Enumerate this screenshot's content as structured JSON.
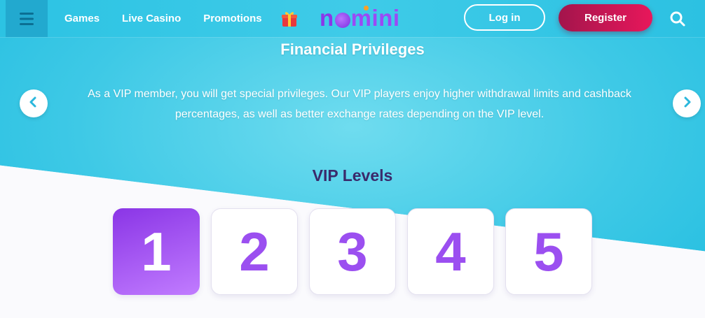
{
  "header": {
    "nav": [
      "Games",
      "Live Casino",
      "Promotions"
    ],
    "logo_text": {
      "n": "n",
      "rest": "mini"
    },
    "login_label": "Log in",
    "register_label": "Register"
  },
  "content": {
    "title": "Financial Privileges",
    "text": "As a VIP member, you will get special privileges. Our VIP players enjoy higher withdrawal limits and cashback percentages, as well as better exchange rates depending on the VIP level.",
    "vip_title": "VIP Levels",
    "levels": [
      "1",
      "2",
      "3",
      "4",
      "5"
    ],
    "active_level": "1"
  },
  "colors": {
    "brand_purple": "#8b36e8",
    "register_red": "#e8175b",
    "header_cyan": "#2cc3e3"
  },
  "icons": [
    "menu-icon",
    "gift-icon",
    "search-icon",
    "chevron-left-icon",
    "chevron-right-icon"
  ]
}
